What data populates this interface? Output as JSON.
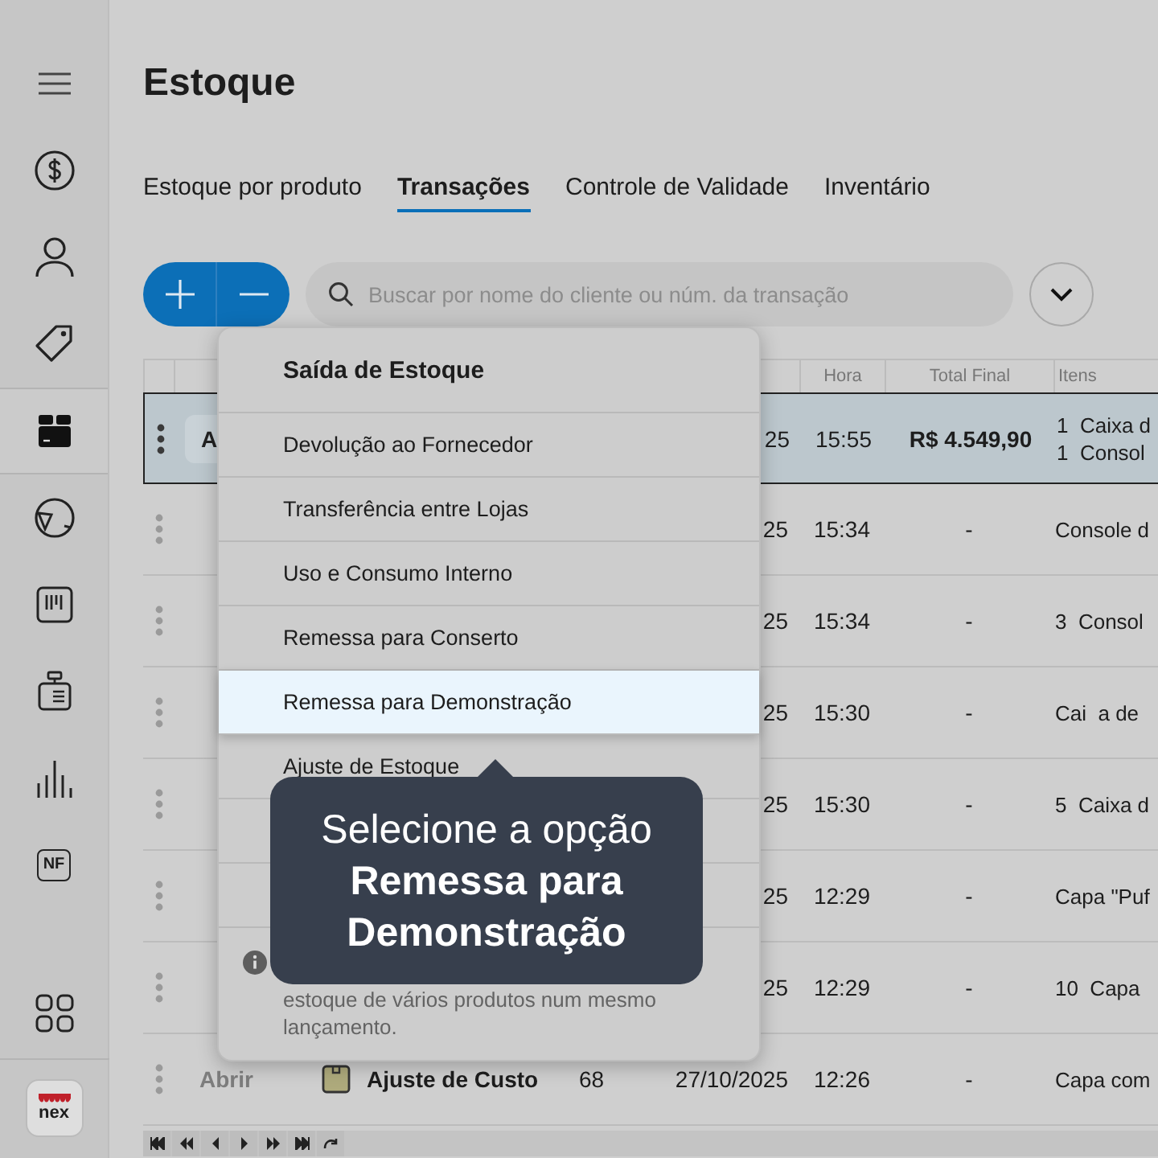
{
  "sidebar": {
    "items": [
      {
        "kind": "menu",
        "selected": false
      },
      {
        "kind": "dollar",
        "selected": false
      },
      {
        "kind": "user",
        "selected": false
      },
      {
        "kind": "tag",
        "selected": false
      },
      {
        "kind": "box",
        "selected": true
      },
      {
        "kind": "globe",
        "selected": false
      },
      {
        "kind": "barcode",
        "selected": false
      },
      {
        "kind": "register",
        "selected": false
      },
      {
        "kind": "chart",
        "selected": false
      },
      {
        "kind": "badge",
        "label": "NF",
        "selected": false
      }
    ],
    "logo": "nex"
  },
  "page": {
    "title": "Estoque"
  },
  "tabs": [
    {
      "label": "Estoque por produto",
      "selected": false
    },
    {
      "label": "Transações",
      "selected": true
    },
    {
      "label": "Controle de Validade",
      "selected": false
    },
    {
      "label": "Inventário",
      "selected": false
    }
  ],
  "search": {
    "placeholder": "Buscar por nome do cliente ou núm. da transação"
  },
  "table": {
    "columns": [
      "Hora",
      "Total Final",
      "Itens"
    ],
    "rows": [
      {
        "selected": true,
        "action": "A",
        "date": "25",
        "hora": "15:55",
        "total": "R$ 4.549,90",
        "itens": [
          "1  Caixa d",
          "1  Consol"
        ]
      },
      {
        "selected": false,
        "date": "25",
        "hora": "15:34",
        "total": "-",
        "itens": [
          "Console d"
        ]
      },
      {
        "selected": false,
        "date": "25",
        "hora": "15:34",
        "total": "-",
        "itens": [
          "3  Consol"
        ]
      },
      {
        "selected": false,
        "date": "25",
        "hora": "15:30",
        "total": "-",
        "itens": [
          "Cai  a de"
        ]
      },
      {
        "selected": false,
        "date": "25",
        "hora": "15:30",
        "total": "-",
        "itens": [
          "5  Caixa d"
        ]
      },
      {
        "selected": false,
        "date": "25",
        "hora": "12:29",
        "total": "-",
        "itens": [
          "Capa \"Puf"
        ]
      },
      {
        "selected": false,
        "date": "25",
        "hora": "12:29",
        "total": "-",
        "itens": [
          "10  Capa"
        ]
      },
      {
        "selected": false,
        "action": "Abrir",
        "type": "Ajuste de Custo",
        "number": "68",
        "date": "27/10/2025",
        "hora": "12:26",
        "total": "-",
        "itens": [
          "Capa com"
        ]
      }
    ]
  },
  "menu": {
    "title": "Saída de Estoque",
    "items": [
      {
        "label": "Devolução ao Fornecedor",
        "selected": false
      },
      {
        "label": "Transferência entre Lojas",
        "selected": false
      },
      {
        "label": "Uso e Consumo Interno",
        "selected": false
      },
      {
        "label": "Remessa para Conserto",
        "selected": false
      },
      {
        "label": "Remessa para Demonstração",
        "selected": true
      },
      {
        "label": "Ajuste de Estoque",
        "selected": false
      }
    ],
    "note_lines": [
      "estoque de vários produtos num mesmo",
      "lançamento."
    ]
  },
  "tooltip": {
    "text": "Selecione a opção **Remessa para Demonstração**"
  }
}
